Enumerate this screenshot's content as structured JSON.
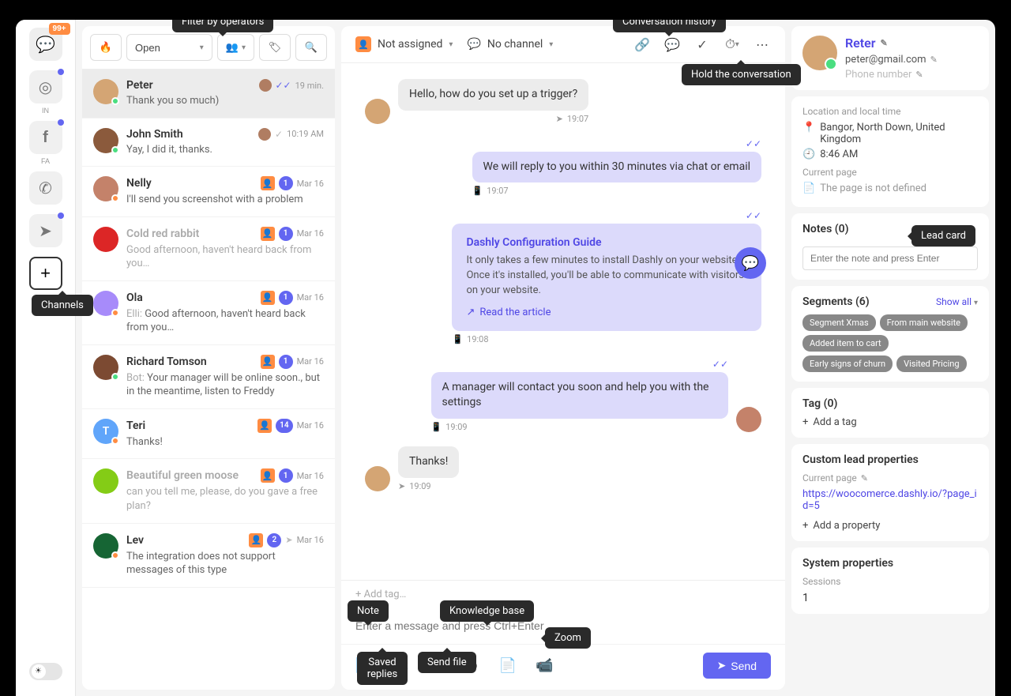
{
  "tooltips": {
    "filter_operators": "Filter by operators",
    "conversation_history": "Conversation history",
    "hold_conversation": "Hold the conversation",
    "channels": "Channels",
    "lead_card": "Lead card",
    "note": "Note",
    "knowledge_base": "Knowledge base",
    "zoom": "Zoom",
    "saved_replies": "Saved replies",
    "send_file": "Send file"
  },
  "channels_rail": {
    "inbox_badge": "99+",
    "instagram_label": "IN",
    "facebook_label": "FA"
  },
  "conv_toolbar": {
    "status_label": "Open"
  },
  "conversations": [
    {
      "name": "Peter",
      "preview": "Thank you so much)",
      "time": "19 min.",
      "checks": true,
      "mini_avatar": true,
      "active": true,
      "status": "#4ade80",
      "avatar_bg": "#d4a574"
    },
    {
      "name": "John Smith",
      "preview": "Yay, I did it, thanks.",
      "time": "10:19 AM",
      "single_check": true,
      "mini_avatar": true,
      "status": "#4ade80",
      "avatar_bg": "#8b5a3c"
    },
    {
      "name": "Nelly",
      "preview": "I'll send you screenshot with a problem",
      "time": "Mar 16",
      "op": true,
      "count": "1",
      "status": "#ff8c42",
      "avatar_bg": "#c4826a"
    },
    {
      "name": "Cold red rabbit",
      "preview": "Good afternoon, haven't heard back from you…",
      "time": "Mar 16",
      "op": true,
      "count": "1",
      "muted": true,
      "avatar_bg": "#dc2626"
    },
    {
      "name": "Ola",
      "preview_prefix": "Elli: ",
      "preview": "Good afternoon, haven't heard back from you…",
      "time": "Mar 16",
      "op": true,
      "count": "1",
      "status": "#ff8c42",
      "avatar_bg": "#a78bfa"
    },
    {
      "name": "Richard Tomson",
      "preview_prefix": "Bot: ",
      "preview": "Your manager will be online soon., but in the meantime, listen to Freddy",
      "time": "Mar 16",
      "op": true,
      "count": "1",
      "status": "#4ade80",
      "avatar_bg": "#7c4a32"
    },
    {
      "name": "Teri",
      "preview": "Thanks!",
      "time": "Mar 16",
      "op": true,
      "count": "14",
      "status": "#ff8c42",
      "avatar_bg": "#60a5fa",
      "avatar_letter": "T"
    },
    {
      "name": "Beautiful green moose",
      "preview": "can you tell me, please, do you gave a free plan?",
      "time": "Mar 16",
      "op": true,
      "count": "1",
      "muted": true,
      "avatar_bg": "#84cc16"
    },
    {
      "name": "Lev",
      "preview": "The integration does not support messages of this type",
      "time": "Mar 16",
      "op": true,
      "count": "2",
      "send_icon": true,
      "status": "#ff8c42",
      "avatar_bg": "#166534"
    }
  ],
  "chat_header": {
    "assignee": "Not assigned",
    "channel": "No channel"
  },
  "messages": {
    "m1": "Hello, how do you set up a trigger?",
    "m1_time": "19:07",
    "m2": "We will reply to you within 30 minutes via chat or email",
    "m2_time": "19:07",
    "kb_title": "Dashly Configuration Guide",
    "kb_desc": "It only takes a few minutes to install Dashly on your website. Once it's installed, you'll be able to communicate with visitors on your website.",
    "kb_link": "Read the article",
    "kb_time": "19:08",
    "m3": "A manager will contact you soon and help you with the settings",
    "m3_time": "19:09",
    "m4": "Thanks!",
    "m4_time": "19:09"
  },
  "compose": {
    "add_tag": "+ Add tag…",
    "placeholder": "Enter a message and press Ctrl+Enter",
    "send": "Send"
  },
  "lead": {
    "name": "Reter",
    "email": "peter@gmail.com",
    "phone_placeholder": "Phone number",
    "location_label": "Location and local time",
    "location": "Bangor, North Down, United Kingdom",
    "local_time": "8:46 AM",
    "current_page_label": "Current page",
    "current_page_value": "The page is not defined",
    "notes_title": "Notes (0)",
    "notes_placeholder": "Enter the note and press Enter",
    "segments_title": "Segments (6)",
    "show_all": "Show all",
    "segments": [
      "Segment Xmas",
      "From main website",
      "Added item to cart",
      "Early signs of churn",
      "Visited Pricing"
    ],
    "tag_title": "Tag (0)",
    "add_tag": "Add a tag",
    "custom_props_title": "Custom lead properties",
    "prop_label": "Current page",
    "prop_value": "https://woocomerce.dashly.io/?page_id=5",
    "add_property": "Add a property",
    "system_props_title": "System properties",
    "sessions_label": "Sessions",
    "sessions_value": "1"
  }
}
